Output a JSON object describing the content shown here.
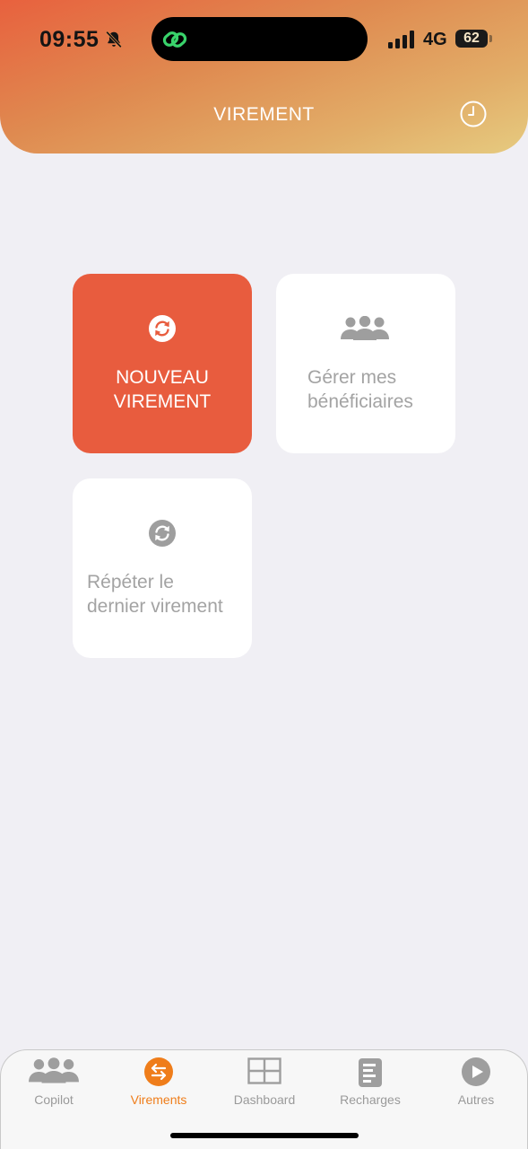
{
  "status_bar": {
    "time": "09:55",
    "network": "4G",
    "battery": "62"
  },
  "header": {
    "title": "VIREMENT",
    "history_icon": "history-icon"
  },
  "colors": {
    "accent": "#e85c3e",
    "tab_active": "#ef7d1a",
    "header_gradient_start": "#e8613e",
    "header_gradient_end": "#e6cb80"
  },
  "actions": [
    {
      "line1": "NOUVEAU",
      "line2": "VIREMENT",
      "icon": "refresh-icon"
    },
    {
      "line1": "Gérer mes",
      "line2": "bénéficiaires",
      "icon": "people-group-icon"
    },
    {
      "line1": "Répéter le",
      "line2": "dernier virement",
      "icon": "refresh-icon"
    }
  ],
  "tabbar": {
    "items": [
      {
        "label": "Copilot",
        "icon": "people-group-icon"
      },
      {
        "label": "Virements",
        "icon": "transfer-arrows-icon",
        "active": true
      },
      {
        "label": "Dashboard",
        "icon": "grid-icon"
      },
      {
        "label": "Recharges",
        "icon": "document-icon"
      },
      {
        "label": "Autres",
        "icon": "play-circle-icon"
      }
    ]
  }
}
